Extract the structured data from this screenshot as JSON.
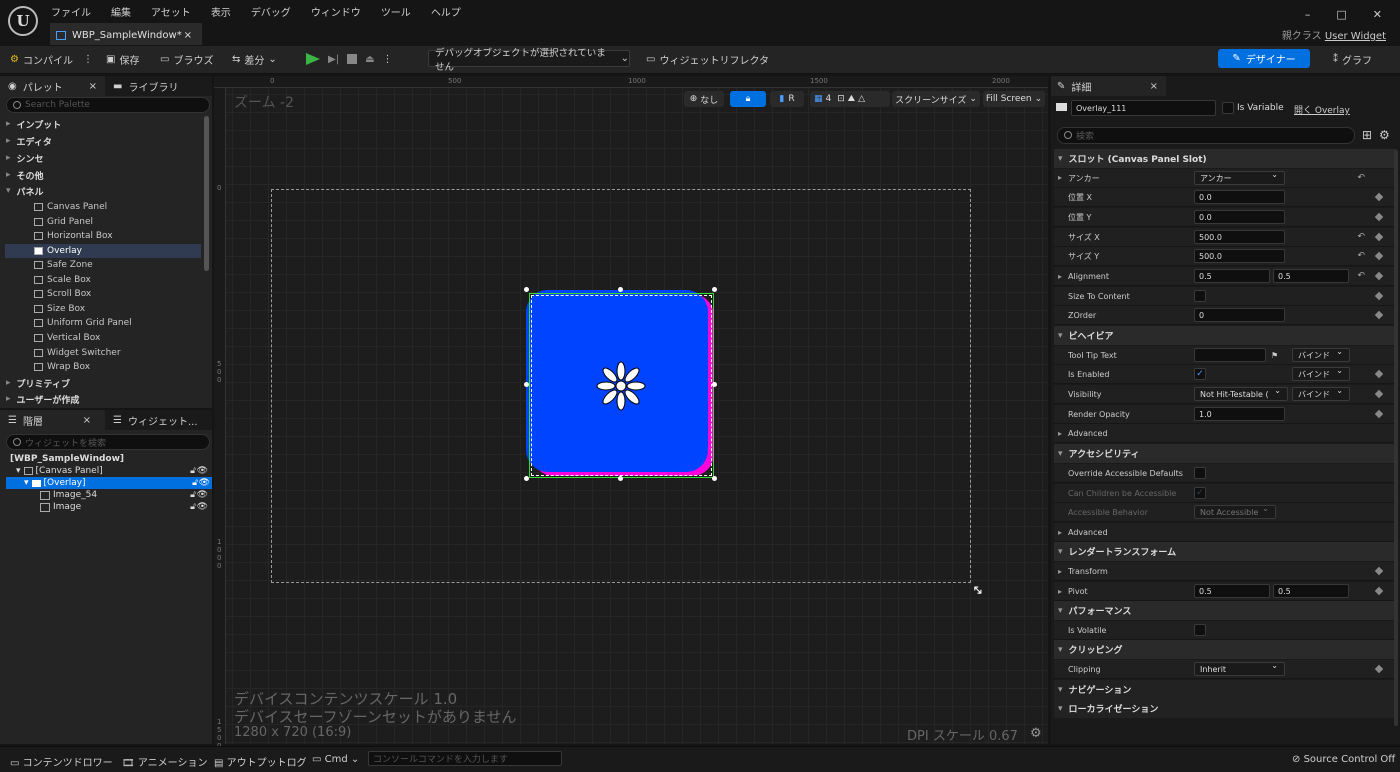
{
  "app": {
    "logo": "U",
    "tab_title": "WBP_SampleWindow*",
    "tab_close": "×",
    "parent_class_label": "親クラス",
    "parent_class_value": "User Widget"
  },
  "menu": [
    "ファイル",
    "編集",
    "アセット",
    "表示",
    "デバッグ",
    "ウィンドウ",
    "ツール",
    "ヘルプ"
  ],
  "window_controls": [
    "–",
    "□",
    "✕"
  ],
  "toolbar": {
    "compile": "コンパイル",
    "save": "保存",
    "browse": "ブラウズ",
    "diff": "差分",
    "debug_object": "デバッグオブジェクトが選択されていません",
    "widget_reflector": "ウィジェットリフレクタ",
    "designer": "デザイナー",
    "graph": "グラフ"
  },
  "palette": {
    "tab": "パレット",
    "tab2": "ライブラリ",
    "search_placeholder": "Search Palette",
    "categories": [
      "インプット",
      "エディタ",
      "シンセ",
      "その他",
      "パネル"
    ],
    "panel_items": [
      "Canvas Panel",
      "Grid Panel",
      "Horizontal Box",
      "Overlay",
      "Safe Zone",
      "Scale Box",
      "Scroll Box",
      "Size Box",
      "Uniform Grid Panel",
      "Vertical Box",
      "Widget Switcher",
      "Wrap Box"
    ],
    "categories_after": [
      "プリミティブ",
      "ユーザーが作成"
    ]
  },
  "hierarchy": {
    "tab": "階層",
    "tab2": "ウィジェット...",
    "search_placeholder": "ウィジェットを検索",
    "nodes": [
      "[WBP_SampleWindow]",
      "[Canvas Panel]",
      "[Overlay]",
      "Image_54",
      "Image"
    ]
  },
  "canvas": {
    "zoom": "ズーム -2",
    "ruler_h": [
      "0",
      "500",
      "1000",
      "1500",
      "2000"
    ],
    "ruler_v": [
      "0",
      "500",
      "1000",
      "1500"
    ],
    "tools": {
      "none": "なし",
      "r": "R",
      "grid": "4",
      "screen_size": "スクリーンサイズ",
      "fill_screen": "Fill Screen"
    },
    "info_scale": "デバイスコンテンツスケール 1.0",
    "info_safe": "デバイスセーフゾーンセットがありません",
    "info_res": "1280 x 720 (16:9)",
    "dpi": "DPI スケール 0.67"
  },
  "details": {
    "tab": "詳細",
    "name_value": "Overlay_111",
    "is_variable": "Is Variable",
    "open_link": "開く Overlay",
    "search_placeholder": "検索",
    "sections": {
      "slot": "スロット (Canvas Panel Slot)",
      "behavior": "ビヘイビア",
      "accessibility": "アクセシビリティ",
      "render": "レンダートランスフォーム",
      "performance": "パフォーマンス",
      "clipping": "クリッピング",
      "navigation": "ナビゲーション",
      "localization": "ローカライゼーション"
    },
    "props": {
      "anchor": "アンカー",
      "anchor_val": "アンカー",
      "pos_x": "位置 X",
      "pos_x_val": "0.0",
      "pos_y": "位置 Y",
      "pos_y_val": "0.0",
      "size_x": "サイズ X",
      "size_x_val": "500.0",
      "size_y": "サイズ Y",
      "size_y_val": "500.0",
      "alignment": "Alignment",
      "align_x": "0.5",
      "align_y": "0.5",
      "size_to_content": "Size To Content",
      "zorder": "ZOrder",
      "zorder_val": "0",
      "tooltip": "Tool Tip Text",
      "bind": "バインド",
      "is_enabled": "Is Enabled",
      "visibility": "Visibility",
      "visibility_val": "Not Hit-Testable (",
      "render_opacity": "Render Opacity",
      "render_opacity_val": "1.0",
      "advanced": "Advanced",
      "override": "Override Accessible Defaults",
      "can_children": "Can Children be Accessible",
      "acc_behavior": "Accessible Behavior",
      "acc_behavior_val": "Not Accessible",
      "transform": "Transform",
      "pivot": "Pivot",
      "pivot_x": "0.5",
      "pivot_y": "0.5",
      "is_volatile": "Is Volatile",
      "clipping": "Clipping",
      "clipping_val": "Inherit"
    }
  },
  "statusbar": {
    "content_drawer": "コンテンツドロワー",
    "animation": "アニメーション",
    "output_log": "アウトプットログ",
    "cmd": "Cmd",
    "console_placeholder": "コンソールコマンドを入力します",
    "source_control": "Source Control Off"
  }
}
